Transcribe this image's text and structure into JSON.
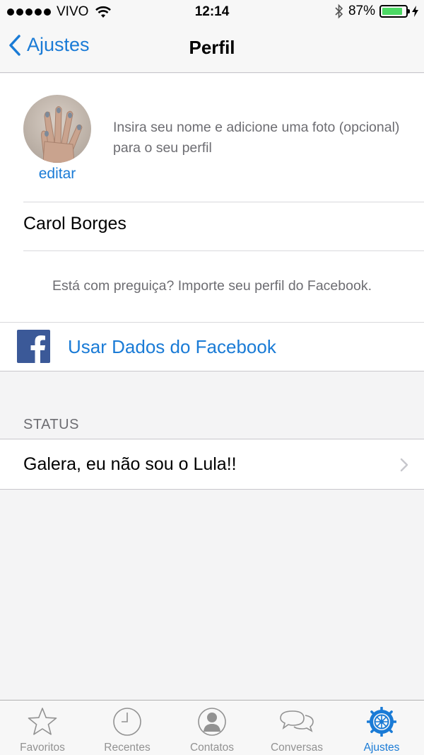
{
  "statusbar": {
    "carrier": "VIVO",
    "time": "12:14",
    "battery_percent": "87%",
    "battery_level": 0.87
  },
  "navbar": {
    "back_label": "Ajustes",
    "title": "Perfil"
  },
  "profile": {
    "edit_label": "editar",
    "hint": "Insira seu nome e adicione uma foto (opcional) para o seu perfil",
    "name_value": "Carol Borges",
    "lazy_text": "Está com preguiça? Importe seu perfil do Facebook.",
    "facebook_label": "Usar Dados do Facebook"
  },
  "status_section": {
    "header": "STATUS",
    "value": "Galera, eu não sou o Lula!!"
  },
  "tabbar": {
    "tabs": [
      {
        "label": "Favoritos",
        "icon": "star-icon"
      },
      {
        "label": "Recentes",
        "icon": "clock-icon"
      },
      {
        "label": "Contatos",
        "icon": "person-icon"
      },
      {
        "label": "Conversas",
        "icon": "chat-bubbles-icon"
      },
      {
        "label": "Ajustes",
        "icon": "gear-icon"
      }
    ],
    "active_index": 4
  },
  "colors": {
    "accent": "#1a7bd6",
    "facebook": "#3b5998",
    "battery": "#4cd964",
    "inactive_tab": "#929292"
  }
}
